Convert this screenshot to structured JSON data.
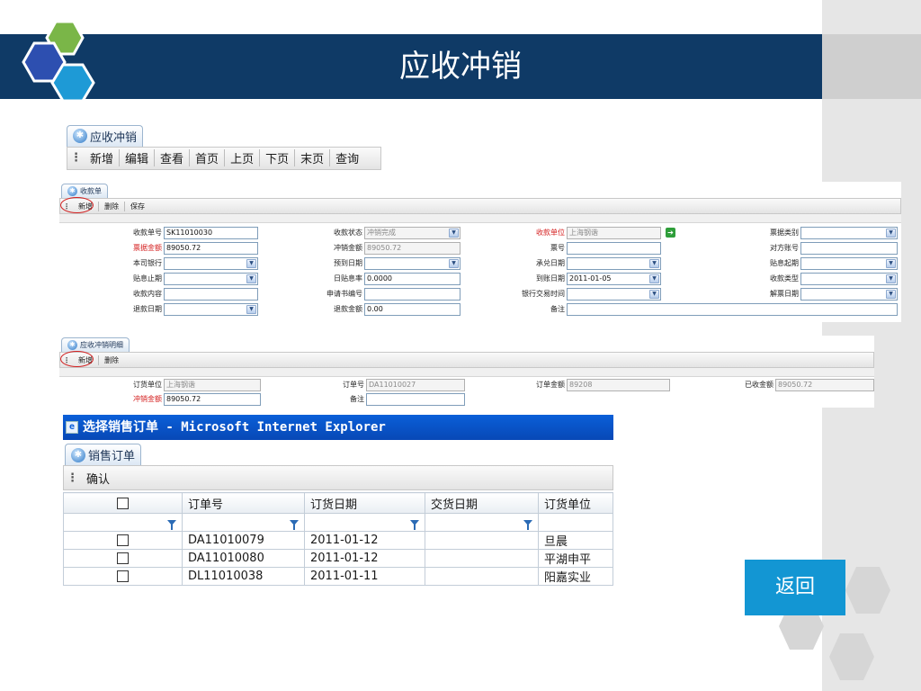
{
  "slide": {
    "title": "应收冲销"
  },
  "module": {
    "tab_label": "应收冲销",
    "toolbar": [
      "新增",
      "编辑",
      "查看",
      "首页",
      "上页",
      "下页",
      "末页",
      "查询"
    ]
  },
  "receipt": {
    "tab_label": "收款单",
    "toolbar": [
      "新增",
      "删除",
      "保存"
    ],
    "rows": [
      [
        {
          "label": "收款单号",
          "value": "SK11010030"
        },
        {
          "label": "收款状态",
          "value": "冲销完成",
          "disabled": true,
          "dropdown": true
        },
        {
          "label": "收款单位",
          "value": "上海钢谐",
          "red": true,
          "disabled": true,
          "go": true
        },
        {
          "label": "票据类别",
          "value": "",
          "dropdown": true
        }
      ],
      [
        {
          "label": "票据金额",
          "value": "89050.72",
          "red": true
        },
        {
          "label": "冲销金额",
          "value": "89050.72",
          "disabled": true
        },
        {
          "label": "票号",
          "value": ""
        },
        {
          "label": "对方账号",
          "value": ""
        }
      ],
      [
        {
          "label": "本司银行",
          "value": "",
          "dropdown": true
        },
        {
          "label": "预到日期",
          "value": "",
          "dropdown": true
        },
        {
          "label": "承兑日期",
          "value": "",
          "dropdown": true
        },
        {
          "label": "贴息起期",
          "value": "",
          "dropdown": true
        }
      ],
      [
        {
          "label": "贴息止期",
          "value": "",
          "dropdown": true
        },
        {
          "label": "日贴息率",
          "value": "0.0000"
        },
        {
          "label": "到账日期",
          "value": "2011-01-05",
          "dropdown": true
        },
        {
          "label": "收款类型",
          "value": "",
          "dropdown": true
        }
      ],
      [
        {
          "label": "收款内容",
          "value": ""
        },
        {
          "label": "申请书编号",
          "value": ""
        },
        {
          "label": "银行交易时间",
          "value": "",
          "dropdown": true
        },
        {
          "label": "解票日期",
          "value": "",
          "dropdown": true
        }
      ],
      [
        {
          "label": "退款日期",
          "value": "",
          "dropdown": true
        },
        {
          "label": "退款金额",
          "value": "0.00"
        },
        {
          "label": "备注",
          "value": "",
          "wide": true
        }
      ]
    ]
  },
  "detail": {
    "tab_label": "应收冲销明细",
    "toolbar": [
      "新增",
      "删除"
    ],
    "rows": [
      [
        {
          "label": "订货单位",
          "value": "上海钢谐",
          "disabled": true
        },
        {
          "label": "订单号",
          "value": "DA11010027",
          "disabled": true
        },
        {
          "label": "订单金额",
          "value": "89208",
          "disabled": true
        },
        {
          "label": "已收金额",
          "value": "89050.72",
          "disabled": true
        }
      ],
      [
        {
          "label": "冲销金额",
          "value": "89050.72",
          "red": true
        },
        {
          "label": "备注",
          "value": ""
        }
      ]
    ]
  },
  "dialog": {
    "window_title": "选择销售订单 - Microsoft Internet Explorer",
    "tab_label": "销售订单",
    "confirm_label": "确认",
    "columns": [
      "订单号",
      "订货日期",
      "交货日期",
      "订货单位"
    ],
    "rows": [
      {
        "order_no": "DA11010079",
        "order_date": "2011-01-12",
        "delivery_date": "",
        "customer": "旦晨"
      },
      {
        "order_no": "DA11010080",
        "order_date": "2011-01-12",
        "delivery_date": "",
        "customer": "平湖申平"
      },
      {
        "order_no": "DL11010038",
        "order_date": "2011-01-11",
        "delivery_date": "",
        "customer": "阳嘉实业"
      }
    ]
  },
  "back_button": "返回",
  "colors": {
    "title_bar": "#0f3a66",
    "accent": "#1396d3",
    "hex_blue": "#2d4fb0",
    "hex_green": "#7ab648",
    "hex_cyan": "#1e9ad6"
  }
}
